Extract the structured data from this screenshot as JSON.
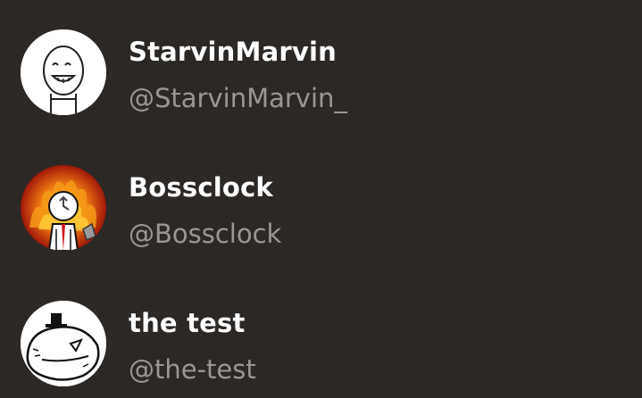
{
  "users": [
    {
      "display_name": "StarvinMarvin",
      "handle": "@StarvinMarvin_",
      "avatar_icon": "doodle-face-avatar"
    },
    {
      "display_name": "Bossclock",
      "handle": "@Bossclock",
      "avatar_icon": "fire-clock-avatar"
    },
    {
      "display_name": "the test",
      "handle": "@the-test",
      "avatar_icon": "hat-blob-avatar"
    }
  ],
  "colors": {
    "background": "#2b2825",
    "display_name": "#ffffff",
    "handle": "#9b9894"
  }
}
